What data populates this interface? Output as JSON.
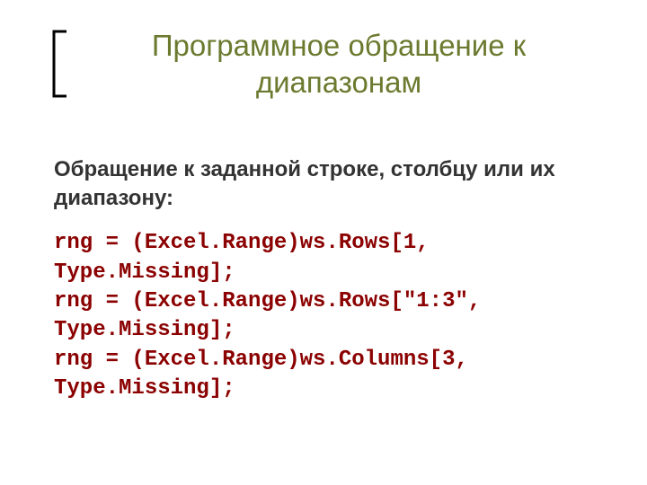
{
  "slide": {
    "title": "Программное обращение к диапазонам",
    "body_text": "Обращение к заданной строке, столбцу или их диапазону:",
    "code": "rng = (Excel.Range)ws.Rows[1, Type.Missing];\nrng = (Excel.Range)ws.Rows[\"1:3\", Type.Missing];\nrng = (Excel.Range)ws.Columns[3, Type.Missing];"
  },
  "colors": {
    "title": "#6B7A2F",
    "code": "#8B0000",
    "text": "#333333"
  },
  "icons": {
    "bracket": "left-square-bracket"
  }
}
